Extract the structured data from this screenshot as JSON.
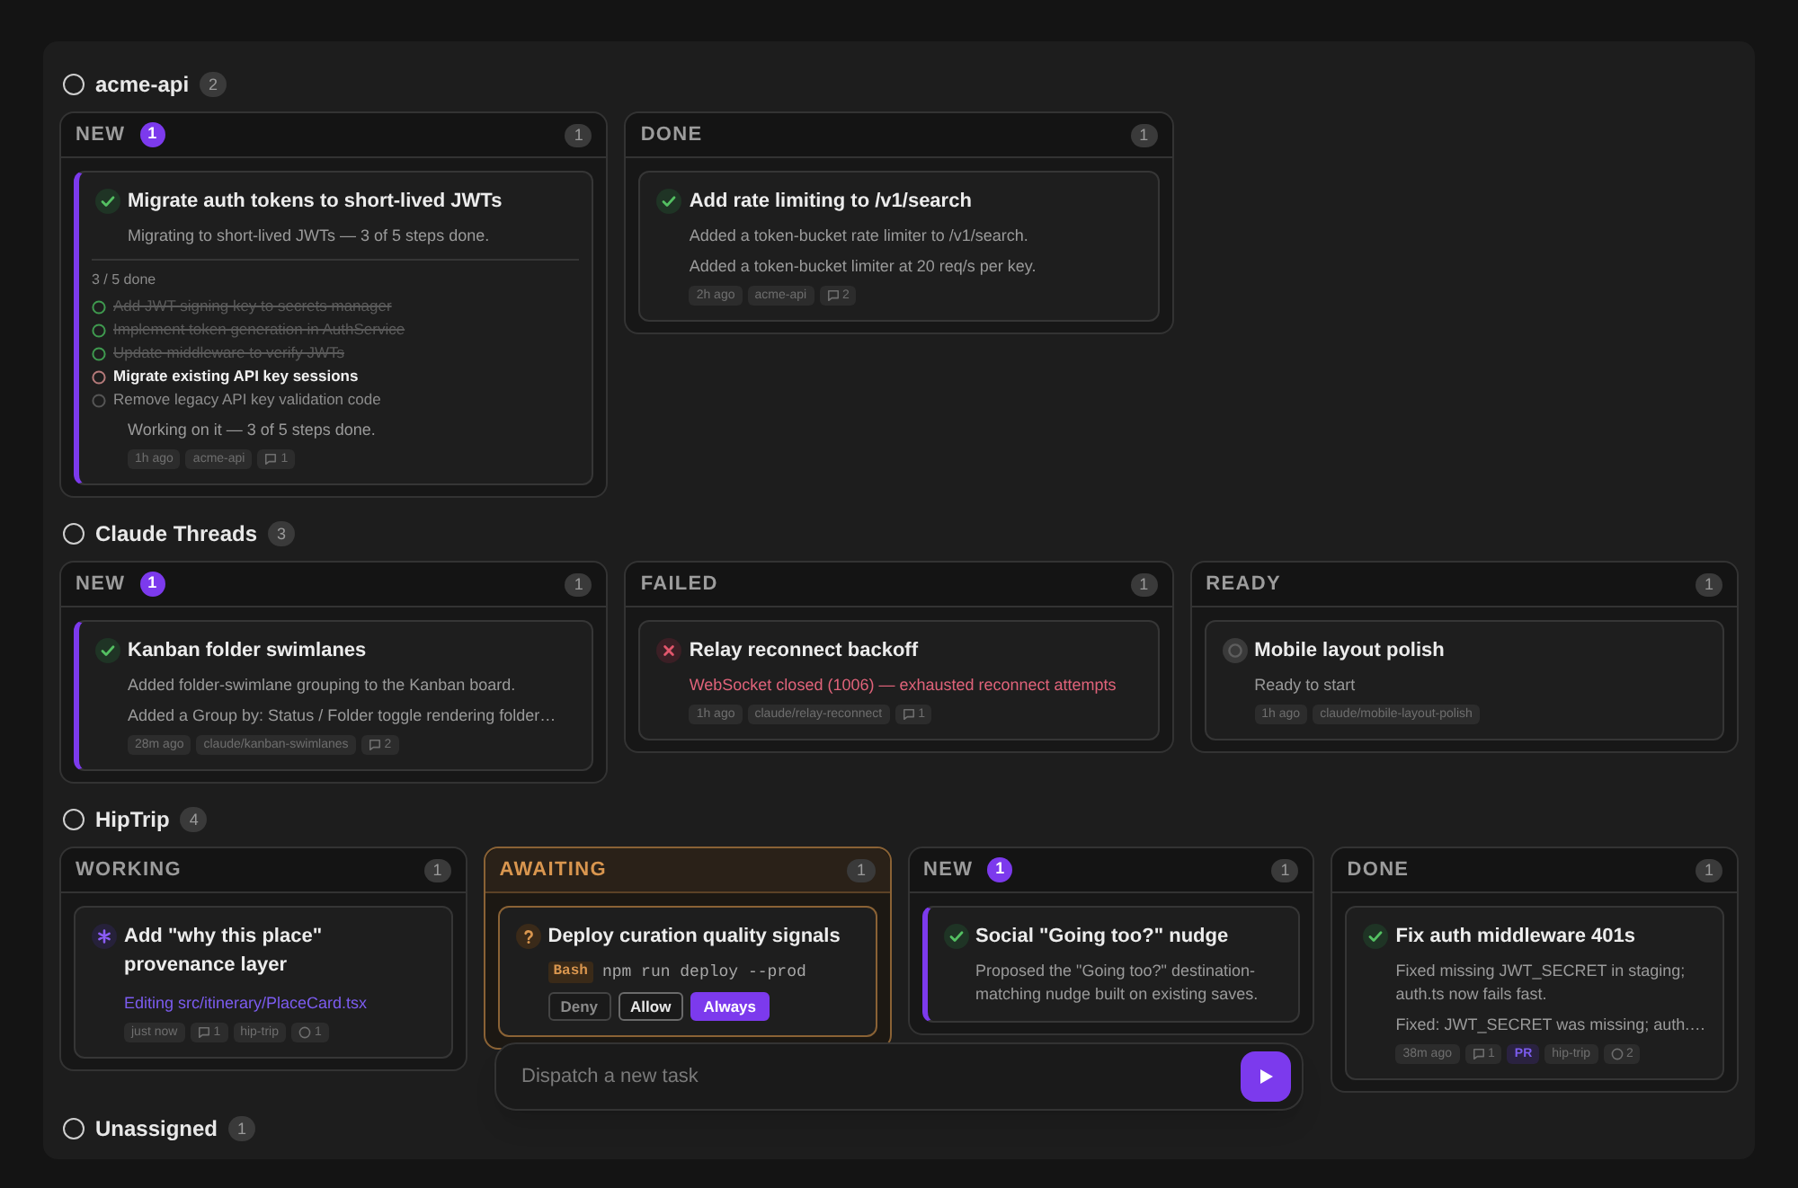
{
  "groups": [
    {
      "name": "acme-api",
      "count": "2",
      "columns": [
        {
          "label": "NEW",
          "badge": "1",
          "count": "1",
          "highlight": false,
          "cards": [
            {
              "kind": "done",
              "accent": true,
              "title": "Migrate auth tokens to short-lived JWTs",
              "body": [
                {
                  "kind": "text",
                  "text": "Migrating to short-lived JWTs — 3 of 5 steps done."
                },
                {
                  "kind": "checklist",
                  "label": "3 / 5 done",
                  "steps": [
                    {
                      "text": "Add JWT signing key to secrets manager",
                      "done": true,
                      "current": false
                    },
                    {
                      "text": "Implement token generation in AuthService",
                      "done": true,
                      "current": false
                    },
                    {
                      "text": "Update middleware to verify JWTs",
                      "done": true,
                      "current": false
                    },
                    {
                      "text": "Migrate existing API key sessions",
                      "done": false,
                      "current": true
                    },
                    {
                      "text": "Remove legacy API key validation code",
                      "done": false,
                      "current": false
                    }
                  ]
                },
                {
                  "kind": "text",
                  "text": "Working on it — 3 of 5 steps done."
                }
              ],
              "tags": [
                {
                  "kind": "label",
                  "text": "1h ago"
                },
                {
                  "kind": "label",
                  "text": "acme-api"
                },
                {
                  "kind": "comments",
                  "text": "1"
                }
              ]
            }
          ]
        },
        {
          "label": "DONE",
          "count": "1",
          "highlight": false,
          "cards": [
            {
              "kind": "done",
              "accent": false,
              "title": "Add rate limiting to /v1/search",
              "body": [
                {
                  "kind": "text",
                  "text": "Added a token-bucket rate limiter to /v1/search."
                },
                {
                  "kind": "text",
                  "text": "Added a token-bucket limiter at 20 req/s per key."
                }
              ],
              "tags": [
                {
                  "kind": "label",
                  "text": "2h ago"
                },
                {
                  "kind": "label",
                  "text": "acme-api"
                },
                {
                  "kind": "comments",
                  "text": "2"
                }
              ]
            }
          ]
        }
      ]
    },
    {
      "name": "Claude Threads",
      "count": "3",
      "columns": [
        {
          "label": "NEW",
          "badge": "1",
          "count": "1",
          "highlight": false,
          "cards": [
            {
              "kind": "done",
              "accent": true,
              "title": "Kanban folder swimlanes",
              "body": [
                {
                  "kind": "text",
                  "text": "Added folder-swimlane grouping to the Kanban board."
                },
                {
                  "kind": "text",
                  "text": "Added a Group by: Status / Folder toggle rendering folder…"
                }
              ],
              "tags": [
                {
                  "kind": "label",
                  "text": "28m ago"
                },
                {
                  "kind": "label",
                  "text": "claude/kanban-swimlanes"
                },
                {
                  "kind": "comments",
                  "text": "2"
                }
              ]
            }
          ]
        },
        {
          "label": "FAILED",
          "count": "1",
          "highlight": false,
          "cards": [
            {
              "kind": "failed",
              "accent": false,
              "title": "Relay reconnect backoff",
              "body": [
                {
                  "kind": "error",
                  "text": "WebSocket closed (1006) — exhausted reconnect attempts"
                }
              ],
              "tags": [
                {
                  "kind": "label",
                  "text": "1h ago"
                },
                {
                  "kind": "label",
                  "text": "claude/relay-reconnect"
                },
                {
                  "kind": "comments",
                  "text": "1"
                }
              ]
            }
          ]
        },
        {
          "label": "READY",
          "count": "1",
          "highlight": false,
          "cards": [
            {
              "kind": "ready",
              "accent": false,
              "title": "Mobile layout polish",
              "body": [
                {
                  "kind": "text",
                  "text": "Ready to start"
                }
              ],
              "tags": [
                {
                  "kind": "label",
                  "text": "1h ago"
                },
                {
                  "kind": "label",
                  "text": "claude/mobile-layout-polish"
                }
              ]
            }
          ]
        }
      ]
    },
    {
      "name": "HipTrip",
      "count": "4",
      "columns": [
        {
          "label": "WORKING",
          "count": "1",
          "highlight": false,
          "cards": [
            {
              "kind": "working",
              "accent": false,
              "title": "Add \"why this place\" provenance layer",
              "body": [
                {
                  "kind": "link",
                  "text": "Editing src/itinerary/PlaceCard.tsx"
                }
              ],
              "tags": [
                {
                  "kind": "label",
                  "text": "just now"
                },
                {
                  "kind": "comments",
                  "text": "1"
                },
                {
                  "kind": "label",
                  "text": "hip-trip"
                },
                {
                  "kind": "runs",
                  "text": "1"
                }
              ]
            }
          ]
        },
        {
          "label": "AWAITING",
          "count": "1",
          "highlight": true,
          "cards": [
            {
              "kind": "awaiting",
              "accent": false,
              "title": "Deploy curation quality signals",
              "body": [
                {
                  "kind": "command",
                  "tool": "Bash",
                  "text": "npm run deploy --prod"
                },
                {
                  "kind": "actions",
                  "buttons": [
                    {
                      "label": "Deny",
                      "kind": "deny"
                    },
                    {
                      "label": "Allow",
                      "kind": "allow"
                    },
                    {
                      "label": "Always",
                      "kind": "always"
                    }
                  ]
                }
              ]
            }
          ]
        },
        {
          "label": "NEW",
          "badge": "1",
          "count": "1",
          "highlight": false,
          "cards": [
            {
              "kind": "done",
              "accent": true,
              "title": "Social \"Going too?\" nudge",
              "body": [
                {
                  "kind": "text",
                  "text": "Proposed the \"Going too?\" destination-matching nudge built on existing saves."
                }
              ]
            }
          ]
        },
        {
          "label": "DONE",
          "count": "1",
          "highlight": false,
          "cards": [
            {
              "kind": "done",
              "accent": false,
              "title": "Fix auth middleware 401s",
              "body": [
                {
                  "kind": "text",
                  "text": "Fixed missing JWT_SECRET in staging; auth.ts now fails fast."
                },
                {
                  "kind": "text",
                  "text": "Fixed: JWT_SECRET was missing; auth.…"
                }
              ],
              "tags": [
                {
                  "kind": "label",
                  "text": "38m ago"
                },
                {
                  "kind": "comments",
                  "text": "1"
                },
                {
                  "kind": "pr",
                  "text": "PR"
                },
                {
                  "kind": "label",
                  "text": "hip-trip"
                },
                {
                  "kind": "runs",
                  "text": "2"
                }
              ]
            }
          ]
        }
      ]
    },
    {
      "name": "Unassigned",
      "count": "1"
    }
  ],
  "dispatch": {
    "placeholder": "Dispatch a new task"
  }
}
